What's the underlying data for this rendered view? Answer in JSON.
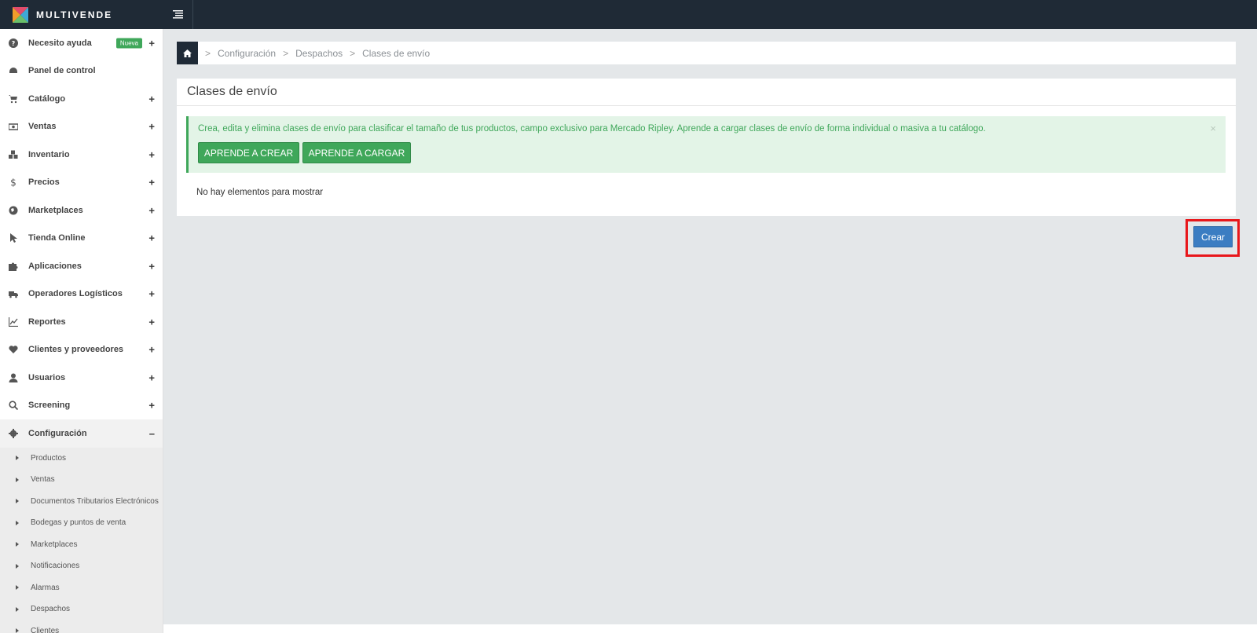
{
  "brand": {
    "name": "MULTIVENDE",
    "accent": "#3fa75a",
    "topbar_color": "#1f2a36"
  },
  "sidebar": {
    "items": [
      {
        "label": "Necesito ayuda",
        "icon": "question-circle-icon",
        "badge": "Nueva",
        "expander": "+"
      },
      {
        "label": "Panel de control",
        "icon": "dashboard-icon",
        "expander": ""
      },
      {
        "label": "Catálogo",
        "icon": "cart-icon",
        "expander": "+"
      },
      {
        "label": "Ventas",
        "icon": "money-icon",
        "expander": "+"
      },
      {
        "label": "Inventario",
        "icon": "cubes-icon",
        "expander": "+"
      },
      {
        "label": "Precios",
        "icon": "dollar-icon",
        "expander": "+"
      },
      {
        "label": "Marketplaces",
        "icon": "globe-icon",
        "expander": "+"
      },
      {
        "label": "Tienda Online",
        "icon": "pointer-icon",
        "expander": "+"
      },
      {
        "label": "Aplicaciones",
        "icon": "puzzle-icon",
        "expander": "+"
      },
      {
        "label": "Operadores Logísticos",
        "icon": "truck-icon",
        "expander": "+"
      },
      {
        "label": "Reportes",
        "icon": "line-chart-icon",
        "expander": "+"
      },
      {
        "label": "Clientes y proveedores",
        "icon": "heart-icon",
        "expander": "+"
      },
      {
        "label": "Usuarios",
        "icon": "user-icon",
        "expander": "+"
      },
      {
        "label": "Screening",
        "icon": "search-icon",
        "expander": "+"
      },
      {
        "label": "Configuración",
        "icon": "gear-icon",
        "expander": "–"
      }
    ],
    "submenu": [
      "Productos",
      "Ventas",
      "Documentos Tributarios Electrónicos",
      "Bodegas y puntos de venta",
      "Marketplaces",
      "Notificaciones",
      "Alarmas",
      "Despachos",
      "Clientes"
    ]
  },
  "breadcrumb": {
    "items": [
      "Configuración",
      "Despachos",
      "Clases de envío"
    ],
    "separator": ">"
  },
  "panel": {
    "title": "Clases de envío",
    "alert": {
      "text": "Crea, edita y elimina clases de envío para clasificar el tamaño de tus productos, campo exclusivo para Mercado Ripley. Aprende a cargar clases de envío de forma individual o masiva a tu catálogo.",
      "close": "×",
      "btn_create": "APRENDE A CREAR",
      "btn_load": "APRENDE A CARGAR"
    },
    "empty_message": "No hay elementos para mostrar"
  },
  "actions": {
    "crear_label": "Crear"
  }
}
